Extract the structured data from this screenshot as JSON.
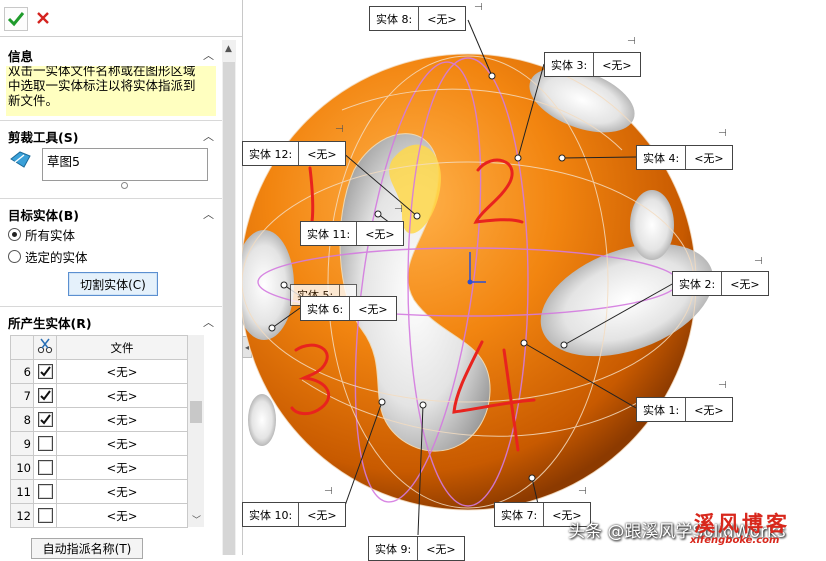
{
  "toolbar": {
    "ok_icon": "checkmark-icon",
    "cancel_icon": "close-icon",
    "ok_color": "#1f9b2c",
    "cancel_color": "#d4231f"
  },
  "info": {
    "title": "信息",
    "message": "双击一实体文件名称或在图形区域\n中选取一实体标注以将实体指派到\n新文件。"
  },
  "trim_tool": {
    "title": "剪裁工具(S)",
    "value": "草图5",
    "icon": "sketch-icon"
  },
  "target_body": {
    "title": "目标实体(B)",
    "option_all": "所有实体",
    "option_selected": "选定的实体",
    "selected": "all",
    "cut_button": "切割实体(C)"
  },
  "resulting_bodies": {
    "title": "所产生实体(R)",
    "header_icon": "scissors-icon",
    "header_file": "文件",
    "rows": [
      {
        "num": "6",
        "checked": true,
        "file": "<无>"
      },
      {
        "num": "7",
        "checked": true,
        "file": "<无>"
      },
      {
        "num": "8",
        "checked": true,
        "file": "<无>"
      },
      {
        "num": "9",
        "checked": false,
        "file": "<无>"
      },
      {
        "num": "10",
        "checked": false,
        "file": "<无>"
      },
      {
        "num": "11",
        "checked": false,
        "file": "<无>"
      },
      {
        "num": "12",
        "checked": false,
        "file": "<无>"
      }
    ],
    "auto_assign_button": "自动指派名称(T)"
  },
  "callouts": [
    {
      "name": "实体 8:",
      "value": "<无>"
    },
    {
      "name": "实体 3:",
      "value": "<无>"
    },
    {
      "name": "实体 12:",
      "value": "<无>"
    },
    {
      "name": "实体 4:",
      "value": "<无>"
    },
    {
      "name": "实体 11:",
      "value": "<无>"
    },
    {
      "name": "实体 5:",
      "value": ""
    },
    {
      "name": "实体 6:",
      "value": "<无>"
    },
    {
      "name": "实体 2:",
      "value": "<无>"
    },
    {
      "name": "实体 1:",
      "value": "<无>"
    },
    {
      "name": "实体 10:",
      "value": "<无>"
    },
    {
      "name": "实体 7:",
      "value": "<无>"
    },
    {
      "name": "实体 9:",
      "value": "<无>"
    }
  ],
  "handwritten_numbers": [
    "1",
    "2",
    "3",
    "4"
  ],
  "watermark": "头条 @跟溪风学SolidWorks",
  "stamp": {
    "text": "溪风博客",
    "url": "xifengbokè.com"
  },
  "colors": {
    "sphere": "#f0820a",
    "annotation": "#e8231e",
    "cut_lines": "#d47ae0",
    "highlight": "#ffffc0"
  }
}
